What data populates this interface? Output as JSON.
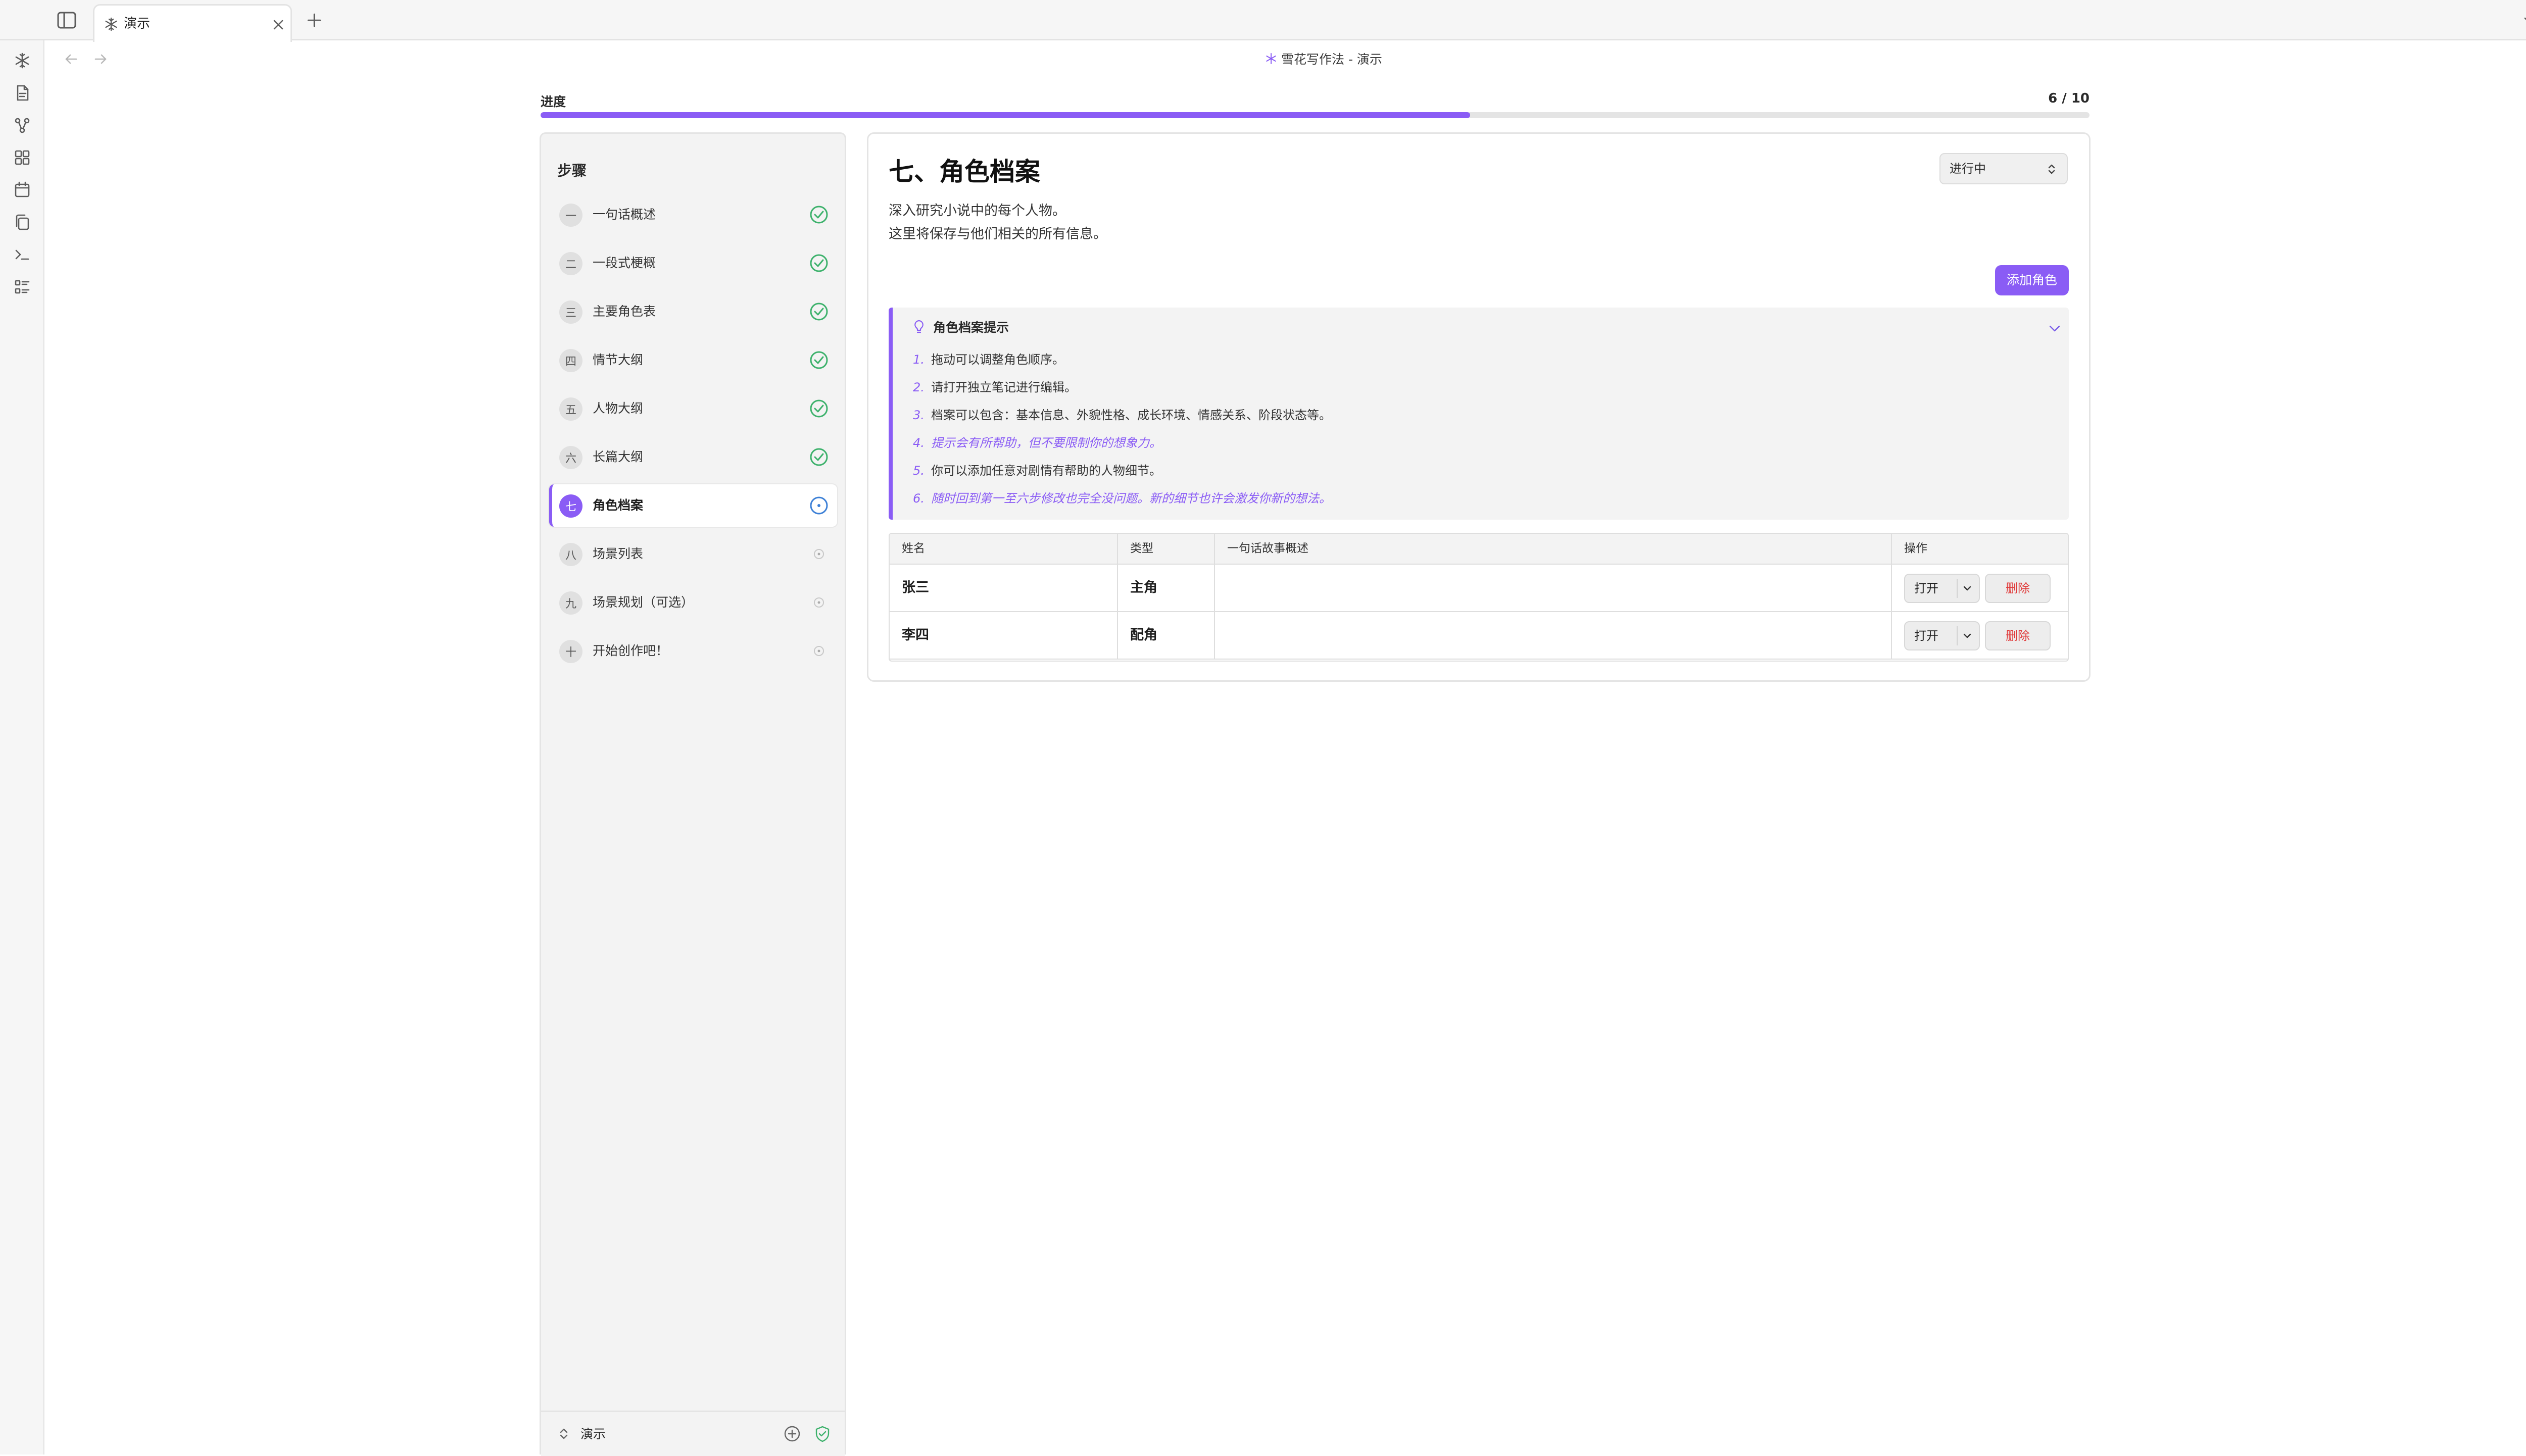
{
  "tab": {
    "label": "演示"
  },
  "view": {
    "title": "雪花写作法 - 演示"
  },
  "progress": {
    "label": "进度",
    "current": 6,
    "total": 10,
    "count_text": "6 / 10",
    "fraction": 0.6
  },
  "steps": {
    "title": "步骤",
    "items": [
      {
        "num": "一",
        "label": "一句话概述",
        "status": "done"
      },
      {
        "num": "二",
        "label": "一段式梗概",
        "status": "done"
      },
      {
        "num": "三",
        "label": "主要角色表",
        "status": "done"
      },
      {
        "num": "四",
        "label": "情节大纲",
        "status": "done"
      },
      {
        "num": "五",
        "label": "人物大纲",
        "status": "done"
      },
      {
        "num": "六",
        "label": "长篇大纲",
        "status": "done"
      },
      {
        "num": "七",
        "label": "角色档案",
        "status": "in-progress"
      },
      {
        "num": "八",
        "label": "场景列表",
        "status": "pending"
      },
      {
        "num": "九",
        "label": "场景规划（可选）",
        "status": "pending"
      },
      {
        "num": "十",
        "label": "开始创作吧！",
        "status": "pending"
      }
    ],
    "footer_label": "演示"
  },
  "section": {
    "title": "七、角色档案",
    "status_value": "进行中",
    "description": [
      "深入研究小说中的每个人物。",
      "这里将保存与他们相关的所有信息。"
    ],
    "add_button": "添加角色"
  },
  "tips": {
    "title": "角色档案提示",
    "items": [
      {
        "num": "1.",
        "text": "拖动可以调整角色顺序。",
        "emphasis": false
      },
      {
        "num": "2.",
        "text": "请打开独立笔记进行编辑。",
        "emphasis": false
      },
      {
        "num": "3.",
        "text": "档案可以包含：基本信息、外貌性格、成长环境、情感关系、阶段状态等。",
        "emphasis": false
      },
      {
        "num": "4.",
        "text": "提示会有所帮助，但不要限制你的想象力。",
        "emphasis": true
      },
      {
        "num": "5.",
        "text": "你可以添加任意对剧情有帮助的人物细节。",
        "emphasis": false
      },
      {
        "num": "6.",
        "text": "随时回到第一至六步修改也完全没问题。新的细节也许会激发你新的想法。",
        "emphasis": true
      }
    ]
  },
  "table": {
    "headers": [
      "姓名",
      "类型",
      "一句话故事概述",
      "操作"
    ],
    "rows": [
      {
        "name": "张三",
        "type": "主角",
        "summary": "",
        "open": "打开",
        "delete": "删除"
      },
      {
        "name": "李四",
        "type": "配角",
        "summary": "",
        "open": "打开",
        "delete": "删除"
      }
    ]
  },
  "colors": {
    "accent": "#8a5cf5",
    "done": "#3cb16b",
    "in_progress": "#3b7fd6",
    "danger": "#e03b3b"
  }
}
